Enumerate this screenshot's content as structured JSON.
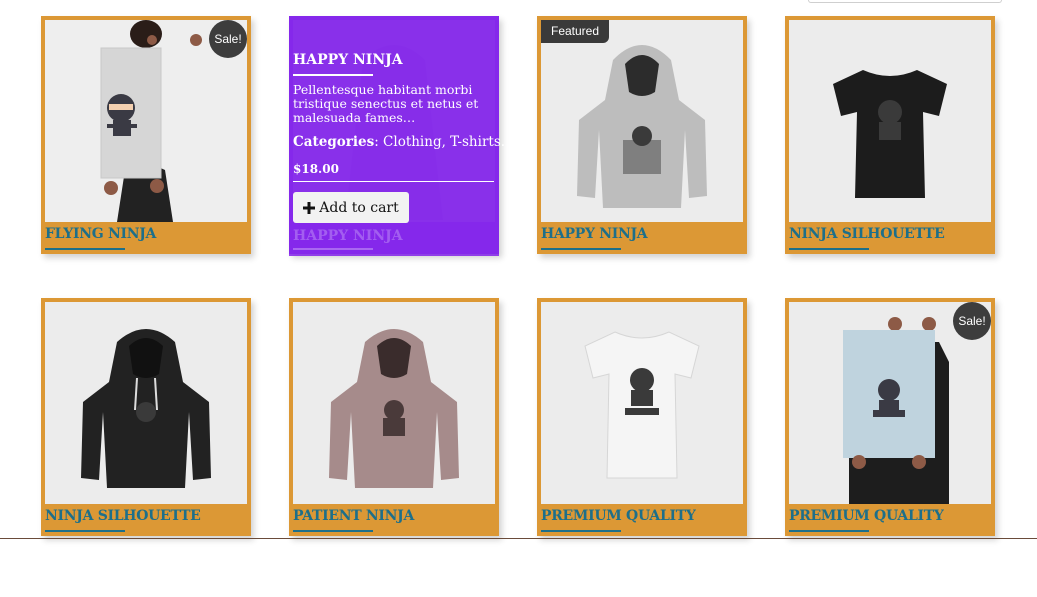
{
  "products": [
    {
      "title": "FLYING NINJA",
      "badge": "Sale!",
      "image": "poster-flying-ninja"
    },
    {
      "title": "HAPPY NINJA",
      "badge": "",
      "image": "hoodie-grey",
      "hover": {
        "title": "HAPPY NINJA",
        "description": "Pellentesque habitant morbi tristique senectus et netus et malesuada fames…",
        "categories_label": "Categories",
        "categories_value": ": Clothing, T-shirts.",
        "price": "$18.00",
        "button_label": "Add to cart",
        "button_icon": "plus-icon"
      }
    },
    {
      "title": "HAPPY NINJA",
      "badge": "Featured",
      "image": "hoodie-light-grey"
    },
    {
      "title": "NINJA SILHOUETTE",
      "badge": "",
      "image": "tshirt-black"
    },
    {
      "title": "NINJA SILHOUETTE",
      "badge": "",
      "image": "hoodie-black"
    },
    {
      "title": "PATIENT NINJA",
      "badge": "",
      "image": "hoodie-mauve"
    },
    {
      "title": "PREMIUM QUALITY",
      "badge": "",
      "image": "tshirt-white"
    },
    {
      "title": "PREMIUM QUALITY",
      "badge": "Sale!",
      "image": "poster-premium-quality"
    }
  ],
  "colors": {
    "card": "#dc9835",
    "title": "#1d6f8a",
    "overlay": "#8528ea",
    "badge": "#3d3d3d"
  }
}
